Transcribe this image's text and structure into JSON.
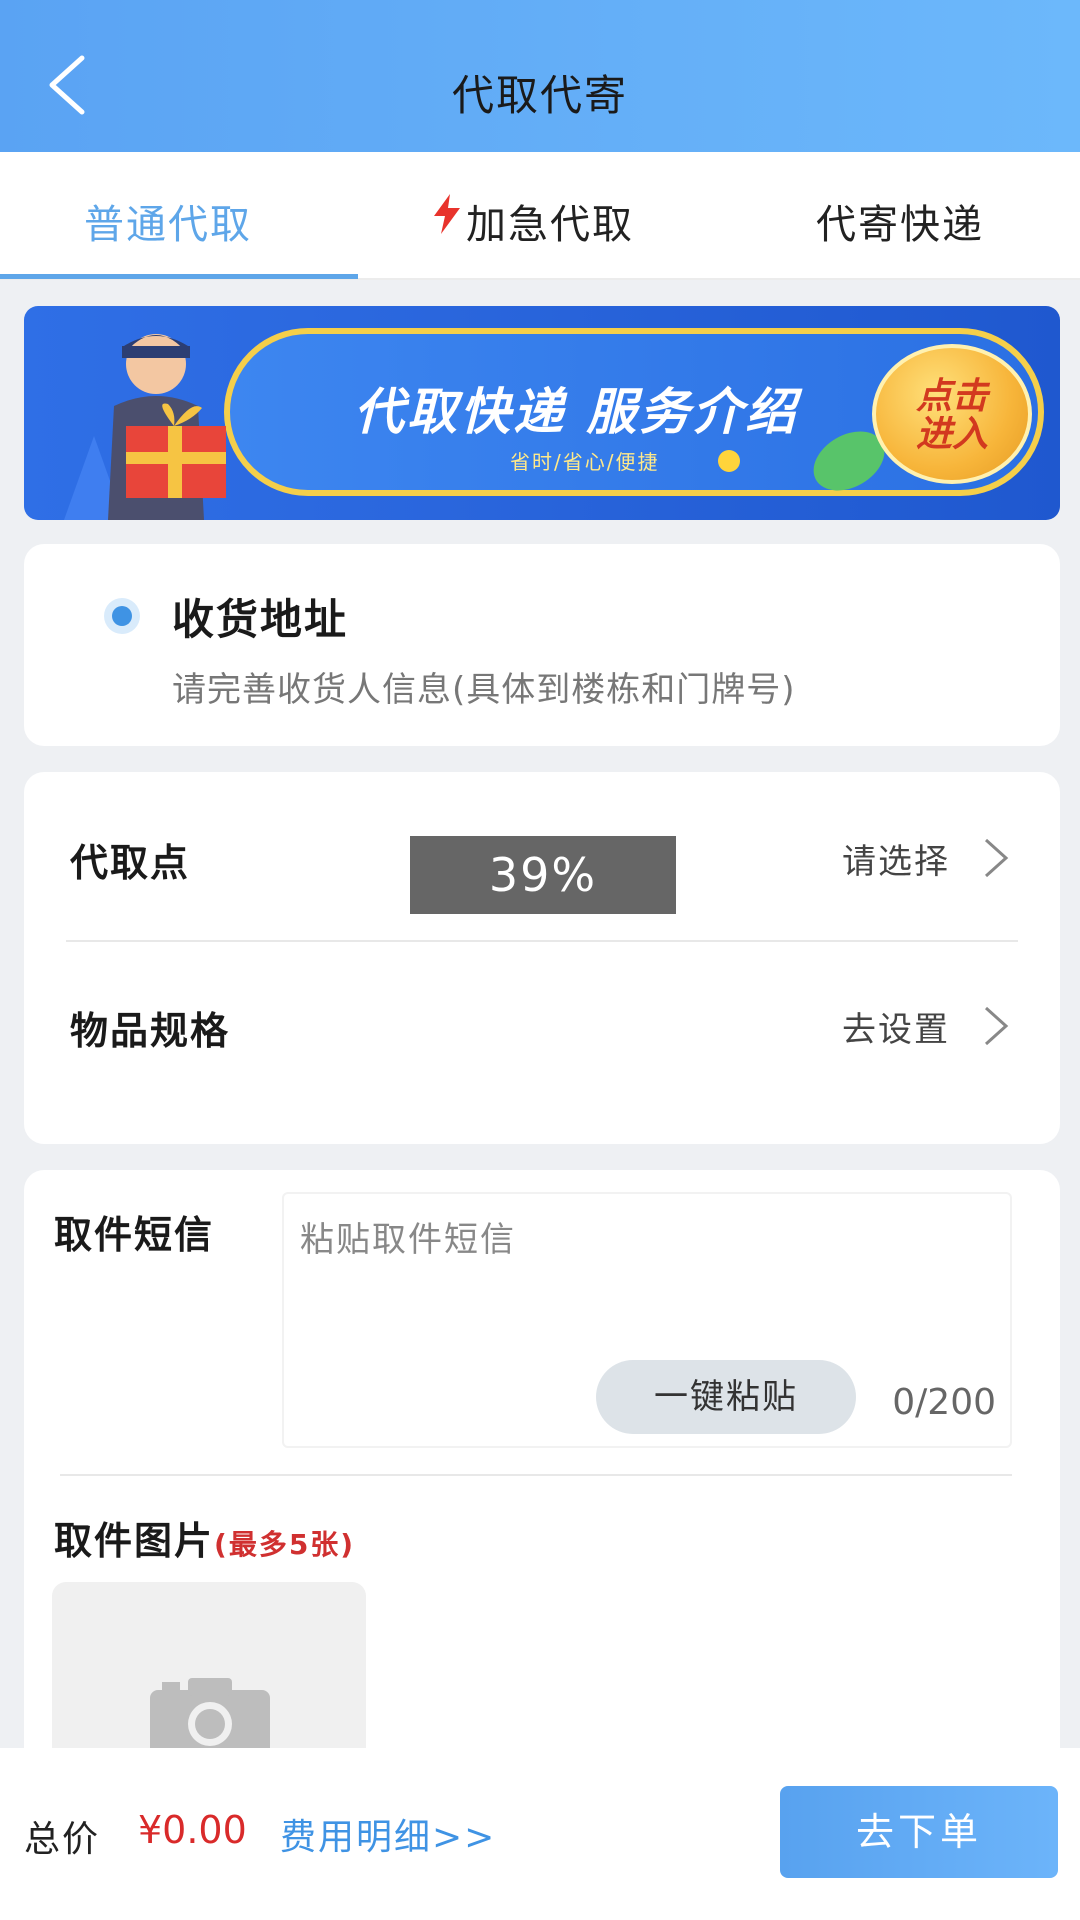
{
  "header": {
    "title": "代取代寄",
    "back_icon": "chevron-left-icon"
  },
  "tabs": [
    {
      "label": "普通代取",
      "active": true
    },
    {
      "label": "加急代取",
      "icon": "lightning-icon",
      "active": false
    },
    {
      "label": "代寄快递",
      "active": false
    }
  ],
  "banner": {
    "title": "代取快递 服务介绍",
    "subtitle": "省时/省心/便捷",
    "button_line1": "点击",
    "button_line2": "进入"
  },
  "address": {
    "title": "收货地址",
    "subtitle": "请完善收货人信息(具体到楼栋和门牌号)"
  },
  "pickup": {
    "point_label": "代取点",
    "point_value": "请选择",
    "spec_label": "物品规格",
    "spec_value": "去设置",
    "progress_text": "39%",
    "progress_value": 39
  },
  "sms": {
    "label": "取件短信",
    "placeholder": "粘贴取件短信",
    "paste_button": "一键粘贴",
    "count": "0/200"
  },
  "photos": {
    "label": "取件图片",
    "hint": "(最多5张)",
    "add_icon": "camera-icon"
  },
  "footer": {
    "total_label": "总价",
    "total_value": "¥0.00",
    "fee_detail_link": "费用明细>>",
    "submit_button": "去下单"
  },
  "colors": {
    "header_gradient_start": "#5aa3f3",
    "header_gradient_end": "#6cb8fb",
    "accent_blue": "#5ea6e9",
    "price_red": "#d92a2a",
    "urgent_red": "#e8332c"
  }
}
